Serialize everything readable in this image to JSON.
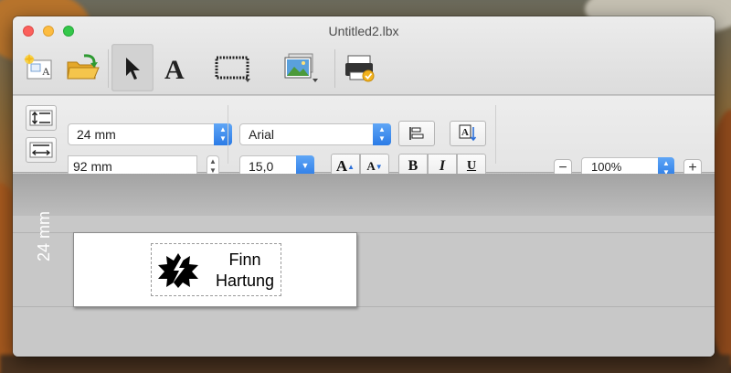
{
  "window": {
    "title": "Untitled2.lbx"
  },
  "toolbar": {
    "buttons": [
      {
        "name": "new-label-icon"
      },
      {
        "name": "open-folder-icon"
      },
      {
        "name": "select-arrow-icon"
      },
      {
        "name": "text-tool-icon"
      },
      {
        "name": "frame-tool-icon"
      },
      {
        "name": "image-tool-icon"
      },
      {
        "name": "print-icon"
      }
    ]
  },
  "format": {
    "label_height": "24 mm",
    "label_length": "92 mm",
    "font_name": "Arial",
    "font_size": "15,0",
    "bold": "B",
    "italic": "I",
    "underline": "U",
    "grow_font": "A",
    "shrink_font": "A",
    "zoom": "100%",
    "zoom_out": "−",
    "zoom_in": "+"
  },
  "canvas": {
    "ruler_label": "24 mm",
    "text_line1": "Finn",
    "text_line2": "Hartung"
  }
}
